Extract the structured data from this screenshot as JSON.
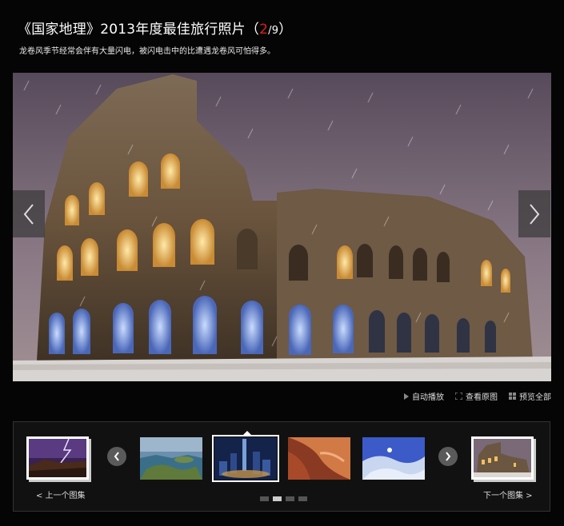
{
  "gallery": {
    "title_prefix": "《国家地理》2013年度最佳旅行照片（",
    "current_index": "2",
    "total": "/9",
    "title_suffix": "）",
    "caption": "龙卷风季节经常会伴有大量闪电，被闪电击中的比遭遇龙卷风可怕得多。"
  },
  "toolbar": {
    "autoplay": "自动播放",
    "view_original": "查看原图",
    "preview_all": "预览全部"
  },
  "strip": {
    "prev_set_label": "< 上一个图集",
    "next_set_label": "下一个图集 >",
    "active_thumb_index": 2,
    "page_count": 4,
    "active_page": 2
  },
  "icons": {
    "left_arrow": "chevron-left-icon",
    "right_arrow": "chevron-right-icon",
    "autoplay": "play-triangle-icon",
    "view_original": "expand-icon",
    "preview_all": "grid-icon"
  }
}
